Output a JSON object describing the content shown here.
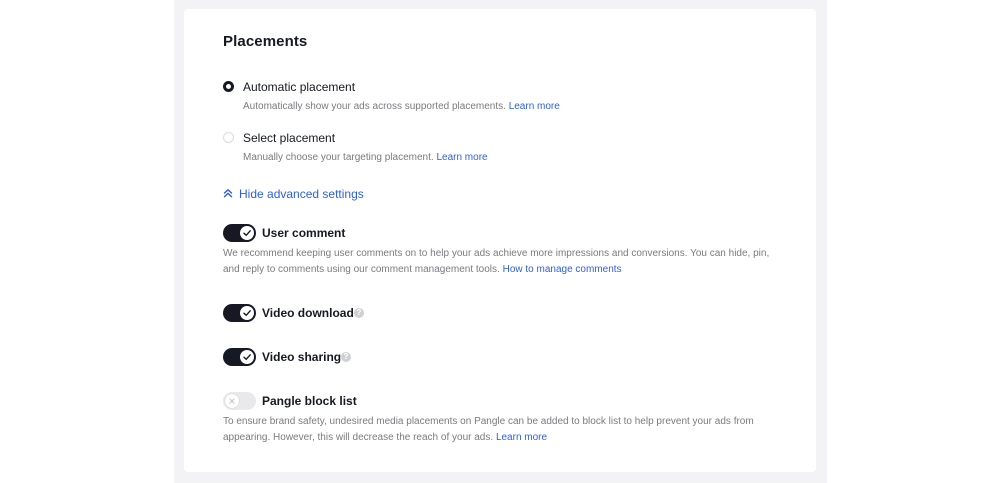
{
  "placements": {
    "title": "Placements",
    "automatic": {
      "label": "Automatic placement",
      "description": "Automatically show your ads across supported placements.",
      "link": "Learn more",
      "selected": true
    },
    "select": {
      "label": "Select placement",
      "description": "Manually choose your targeting placement.",
      "link": "Learn more",
      "selected": false
    },
    "advanced_toggle_label": "Hide advanced settings",
    "settings": {
      "user_comment": {
        "label": "User comment",
        "enabled": true,
        "description_line1": "We recommend keeping user comments on to help your ads achieve more impressions and conversions. You can hide, pin,",
        "description_line2": "and reply to comments using our comment management tools.",
        "link": "How to manage comments"
      },
      "video_download": {
        "label": "Video download",
        "enabled": true,
        "help": "?"
      },
      "video_sharing": {
        "label": "Video sharing",
        "enabled": true,
        "help": "?"
      },
      "pangle_block_list": {
        "label": "Pangle block list",
        "enabled": false,
        "description_line1": "To ensure brand safety, undesired media placements on Pangle can be added to block list to help prevent your ads from",
        "description_line2": "appearing. However, this will decrease the reach of your ads.",
        "link": "Learn more"
      }
    }
  },
  "colors": {
    "accent": "#2c5ee6",
    "text_primary": "#161823",
    "text_secondary": "#7a7b80",
    "switch_on": "#161823",
    "switch_off": "#e9e9eb",
    "page_background": "#f3f3f5"
  },
  "icons": {
    "advanced": "double-chevron-up-icon",
    "switch_on": "check-icon",
    "switch_off": "x-icon",
    "help": "help-circle-icon"
  }
}
